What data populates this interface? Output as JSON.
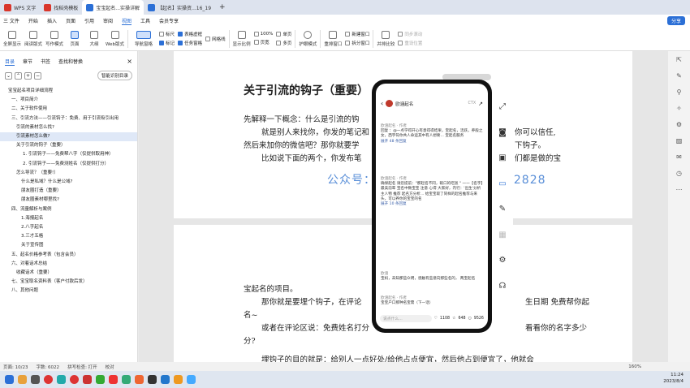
{
  "titlebar": {
    "tabs": [
      {
        "label": "WPS 文字",
        "color": "#d9362b"
      },
      {
        "label": "找稻壳模板",
        "color": "#d9362b"
      },
      {
        "label": "宝宝起名...实操详解",
        "color": "#2b6fd6"
      },
      {
        "label": "【起名】实操资...16_19",
        "color": "#2b6fd6"
      }
    ],
    "new_tab": "+"
  },
  "menubar": {
    "items": [
      "三 文件",
      "开始",
      "插入",
      "页面",
      "引用",
      "审阅",
      "视图",
      "工具",
      "会员专享"
    ],
    "active": "视图",
    "share_label": "分享"
  },
  "ribbon": {
    "buttons": [
      "全屏显示",
      "阅读版式",
      "写作模式",
      "页面",
      "大纲",
      "Web版式"
    ],
    "nav_pane": "导航窗格",
    "checks": [
      {
        "label": "标尺",
        "on": false
      },
      {
        "label": "表格虚框",
        "on": true
      },
      {
        "label": "网格线",
        "on": false
      },
      {
        "label": "标记",
        "on": true
      },
      {
        "label": "任务窗格",
        "on": true
      }
    ],
    "zoom_buttons": [
      "显示比例",
      "100%",
      "页宽",
      "单页",
      "多页"
    ],
    "eye_mode": "护眼模式",
    "window_buttons": [
      "重排窗口",
      "新建窗口",
      "拆分窗口",
      "并排比较",
      "同步滚动",
      "重设位置"
    ]
  },
  "left_panel": {
    "tabs": [
      "目录",
      "章节",
      "书签",
      "查找和替换"
    ],
    "smart_button": "智能识别目录",
    "toc": [
      "宝宝起名项目详细流程",
      "一、项目简介",
      "二、关于软件使用",
      "三、引流方法——引流钩子：免费、用于引流吸引出用",
      "引流的素材怎么找?",
      "引流素材怎么做?",
      "关于引流的钩子（重要）",
      "1. 引流钩子——免费帮八字（仅提供取用神）",
      "2. 引流钩子——免费测姓名（仅提供打分）",
      "怎么导流？（重要!）",
      "什么是私域？什么是公域?",
      "朋友圈打造（重要）",
      "朋友圈素材哪里找?",
      "四、流量解析与案例",
      "1.海报起名",
      "2.八字起名",
      "3.三才五格",
      "关于宣传图",
      "五、起名价格参考表（包含会员）",
      "六、对着话术总结",
      "收藏话术（重要）",
      "七、宝宝取名资料表（客户付款后发）",
      "八、其他问题"
    ],
    "selected": "引流素材怎么做?"
  },
  "document": {
    "heading": "关于引流的钩子（重要）",
    "lines": [
      "先解释一下概念：什么是引流的钩",
      "就是别人来找你，你发的笔记和",
      "然后来加你的微信吧？那你就要学",
      "比如说下面的两个，你发布笔"
    ],
    "right_lines": [
      "你可以信任,",
      "下钩子。",
      "们都是做的宝"
    ],
    "watermark": "公众号：视频笔记    微信：2435662828",
    "page2_lines": [
      "宝起名的项目。",
      "那你就是要埋个钩子，在评论",
      "名~",
      "或者在评论区说：免费姓名打分",
      "分?",
      "埋钩子的目的就是：给别人一点好处/给他占点便宜，然后他占到便宜了，他就会"
    ],
    "page2_right": [
      "生日期 免费帮你起",
      "看看你的名字多少"
    ]
  },
  "phone": {
    "header_name": "欧涵起名",
    "header_label": "CTX",
    "comments": [
      {
        "user": "欧涵起名 · 作者",
        "text": "回复 ：@一点学得开心有意得得结果，宝起名，活跃，养般之女，西宇符你共人命运其中有人想要... 宝起名服务",
        "meta": "展开 48 条回复"
      },
      {
        "user": "欧涵起名 · 作者",
        "text": "确保起名 请您提前：\"那起名不同，碗口的吃饭 \" 一一【名字】最美前辈 宝名中数宝宝 注意 心得 大家好，内行：'出生'分析主人物 推荐 起名方分析... 给宝宝取了同样的起名推荐与来头，可以养你的宝宝的名",
        "meta": "展开 10 条回复"
      },
      {
        "user": "欧涵",
        "text": "宝妈，未知那些众明，感触有些意向那些名的， 两宝起名",
        "meta": ""
      },
      {
        "user": "欧涵起名 · 作者",
        "text": "宝宝户口那种名宝需（下一话）",
        "meta": ""
      }
    ],
    "input_placeholder": "说点什么...",
    "likes": "1108",
    "stars": "648",
    "comment_count": "9526"
  },
  "statusbar": {
    "page": "页面: 10/23",
    "words": "字数: 6022",
    "spell": "拼写检查: 打开",
    "proof": "校对",
    "zoom": "160%"
  },
  "clock": {
    "time": "11:24",
    "date": "2023/8/4"
  }
}
